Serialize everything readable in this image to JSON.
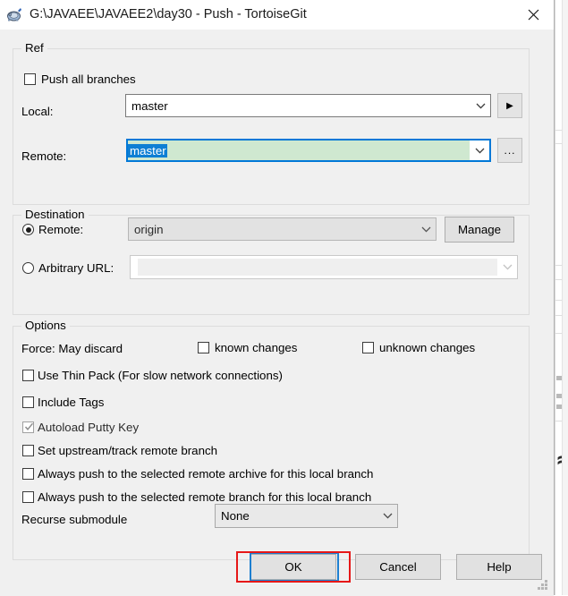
{
  "window": {
    "title": "G:\\JAVAEE\\JAVAEE2\\day30 - Push - TortoiseGit",
    "app_icon": "tortoisegit-turtle-icon",
    "close_label": "✕"
  },
  "ref_group": {
    "title": "Ref",
    "push_all_branches": {
      "label": "Push all branches",
      "checked": false
    },
    "local": {
      "label": "Local:",
      "value": "master",
      "browse_button_label": "▶"
    },
    "remote": {
      "label": "Remote:",
      "value": "master",
      "selected_text": "master",
      "browse_button_label": "...",
      "field_bg_color": "#cfe8d0",
      "selection_color": "#0e7fd4",
      "focus_color": "#0078d7"
    }
  },
  "destination_group": {
    "title": "Destination",
    "remote_radio": {
      "label": "Remote:",
      "selected": true,
      "value": "origin"
    },
    "arbitrary_url_radio": {
      "label": "Arbitrary URL:",
      "selected": false,
      "value": ""
    },
    "manage_button": {
      "label": "Manage"
    }
  },
  "options_group": {
    "title": "Options",
    "force_label": "Force: May discard",
    "force_known_changes": {
      "label": "known changes",
      "checked": false
    },
    "force_unknown_changes": {
      "label": "unknown changes",
      "checked": false
    },
    "checkboxes": [
      {
        "label": "Use Thin Pack (For slow network connections)",
        "checked": false
      },
      {
        "label": "Include Tags",
        "checked": false
      },
      {
        "label": "Autoload Putty Key",
        "checked": true
      },
      {
        "label": "Set upstream/track remote branch",
        "checked": false
      },
      {
        "label": "Always push to the selected remote archive for this local branch",
        "checked": false
      },
      {
        "label": "Always push to the selected remote branch for this local branch",
        "checked": false
      }
    ],
    "recurse_submodule": {
      "label": "Recurse submodule",
      "value": "None"
    }
  },
  "footer": {
    "ok_button": {
      "label": "OK",
      "focused": true,
      "annotation_color": "#e61717",
      "focus_color": "#1d7fd0"
    },
    "cancel_button": {
      "label": "Cancel"
    },
    "help_button": {
      "label": "Help"
    }
  }
}
